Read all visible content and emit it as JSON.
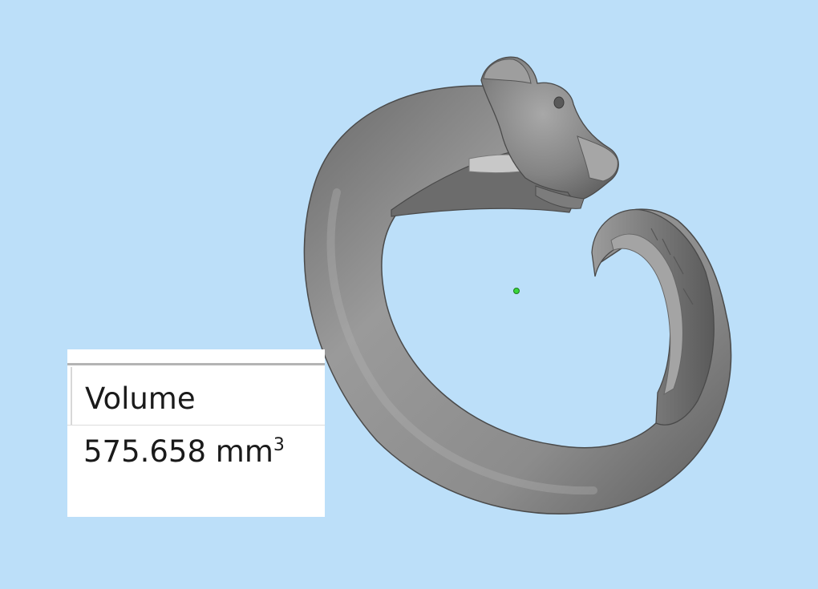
{
  "viewport": {
    "background_color": "#bcdff9",
    "model_name": "panther-ring-3d-model",
    "model_color": "#8a8a8a",
    "pivot_marker_color": "#39d63a"
  },
  "properties_panel": {
    "label": "Volume",
    "value": "575.658",
    "unit": "mm",
    "unit_exponent": "3"
  }
}
